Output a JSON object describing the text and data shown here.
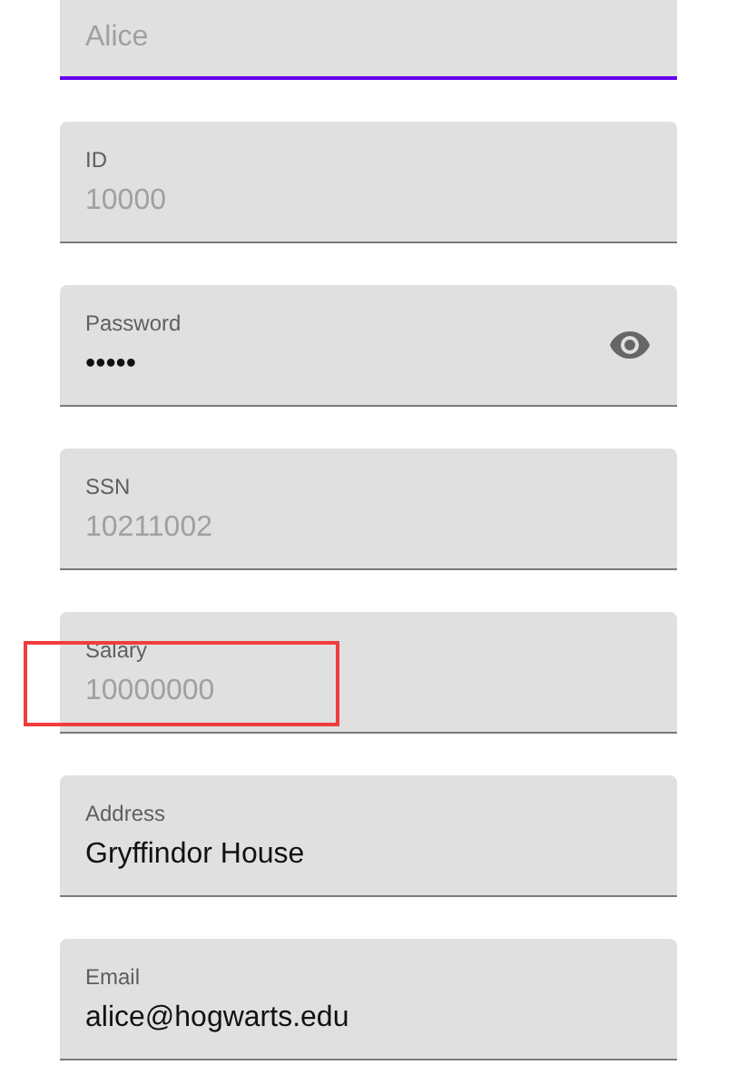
{
  "fields": [
    {
      "kind": "text",
      "value": "Alice",
      "disabled": true,
      "focused": true,
      "highlighted": false
    },
    {
      "kind": "text",
      "label": "ID",
      "value": "10000",
      "disabled": true,
      "focused": false,
      "highlighted": false
    },
    {
      "kind": "password",
      "label": "Password",
      "value": "•••••",
      "disabled": false,
      "focused": false,
      "highlighted": false
    },
    {
      "kind": "text",
      "label": "SSN",
      "value": "10211002",
      "disabled": true,
      "focused": false,
      "highlighted": false
    },
    {
      "kind": "text",
      "label": "Salary",
      "value": "10000000",
      "disabled": true,
      "focused": false,
      "highlighted": true
    },
    {
      "kind": "text",
      "label": "Address",
      "value": "Gryffindor House",
      "disabled": false,
      "focused": false,
      "highlighted": false
    },
    {
      "kind": "text",
      "label": "Email",
      "value": "alice@hogwarts.edu",
      "disabled": false,
      "focused": false,
      "highlighted": false
    }
  ]
}
